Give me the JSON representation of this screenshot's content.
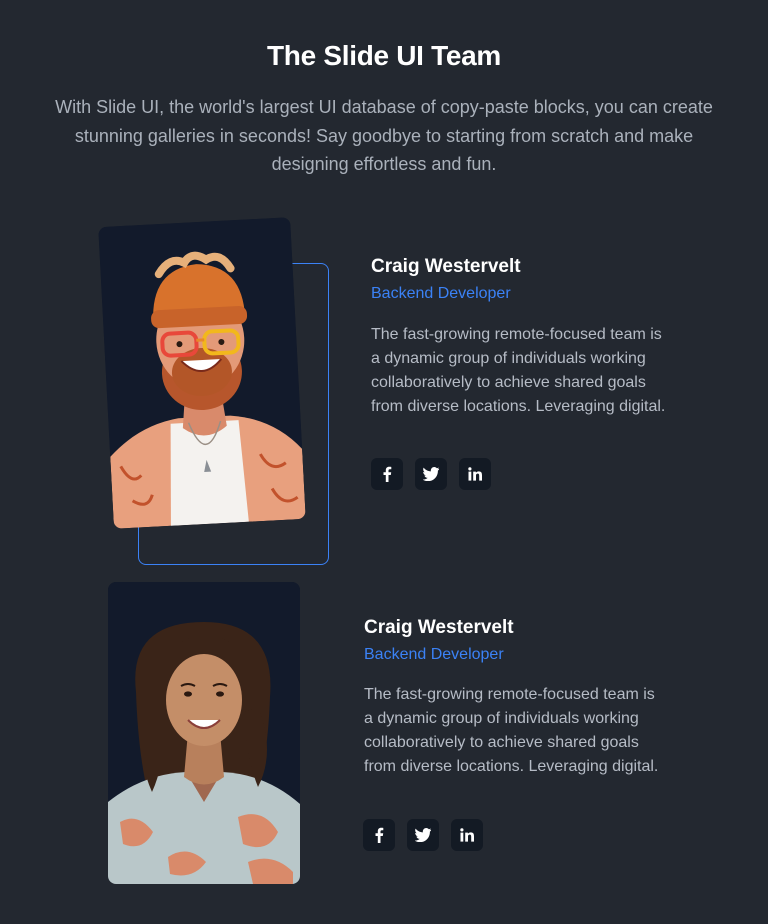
{
  "header": {
    "title": "The Slide UI Team",
    "description": "With Slide UI, the world's largest UI database of copy-paste blocks, you can create stunning galleries in seconds! Say goodbye to starting from scratch and make designing effortless and fun."
  },
  "members": [
    {
      "name": "Craig Westervelt",
      "role": "Backend Developer",
      "bio": "The fast-growing remote-focused team is a dynamic group of individuals working collaboratively to achieve shared goals from diverse locations. Leveraging digital.",
      "socials": [
        "facebook-icon",
        "twitter-icon",
        "linkedin-icon"
      ]
    },
    {
      "name": "Craig Westervelt",
      "role": "Backend Developer",
      "bio": "The fast-growing remote-focused team is a dynamic group of individuals working collaboratively to achieve shared goals from diverse locations. Leveraging digital.",
      "socials": [
        "facebook-icon",
        "twitter-icon",
        "linkedin-icon"
      ]
    }
  ],
  "colors": {
    "background": "#232830",
    "accent": "#3b82f6",
    "photo_bg": "#121a2b",
    "icon_bg": "#131a24"
  }
}
